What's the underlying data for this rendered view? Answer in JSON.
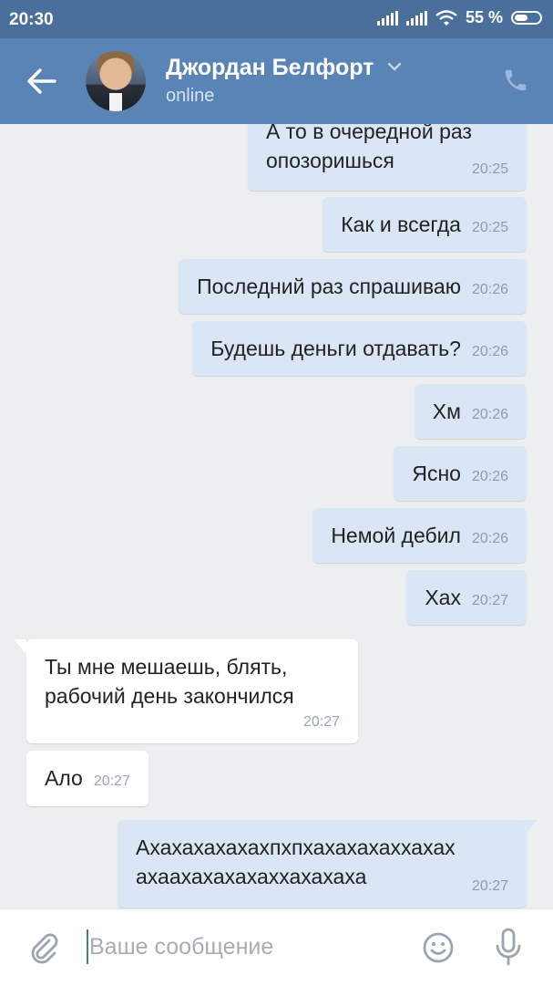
{
  "status_bar": {
    "time": "20:30",
    "battery_percent": "55 %",
    "icons": [
      "signal-icon",
      "signal-icon",
      "wifi-icon",
      "battery-icon"
    ]
  },
  "header": {
    "contact_name": "Джордан Белфорт",
    "presence": "online",
    "icons": [
      "back-arrow-icon",
      "chevron-down-icon",
      "phone-icon"
    ]
  },
  "messages": [
    {
      "direction": "out",
      "text": "А то в очередной раз опозоришься",
      "time": "20:25"
    },
    {
      "direction": "out",
      "text": "Как и всегда",
      "time": "20:25"
    },
    {
      "direction": "out",
      "text": "Последний раз спрашиваю",
      "time": "20:26"
    },
    {
      "direction": "out",
      "text": "Будешь деньги отдавать?",
      "time": "20:26"
    },
    {
      "direction": "out",
      "text": "Хм",
      "time": "20:26"
    },
    {
      "direction": "out",
      "text": "Ясно",
      "time": "20:26"
    },
    {
      "direction": "out",
      "text": "Немой дебил",
      "time": "20:26"
    },
    {
      "direction": "out",
      "text": "Хах",
      "time": "20:27"
    },
    {
      "direction": "in",
      "text": "Ты мне мешаешь, блять, рабочий день закончился",
      "time": "20:27"
    },
    {
      "direction": "in",
      "text": "Ало",
      "time": "20:27"
    },
    {
      "direction": "out",
      "text": "Ахахахахахахпхпхахахахаххахах ахаахахахахаххахахаха",
      "time": "20:27"
    }
  ],
  "composer": {
    "placeholder": "Ваше сообщение",
    "value": "",
    "icons": [
      "paperclip-icon",
      "emoji-icon",
      "microphone-icon"
    ]
  },
  "colors": {
    "header": "#5b84b6",
    "status_bar": "#4a6f9c",
    "outgoing_bubble": "#dae6f5",
    "incoming_bubble": "#ffffff",
    "background": "#edeef0"
  }
}
